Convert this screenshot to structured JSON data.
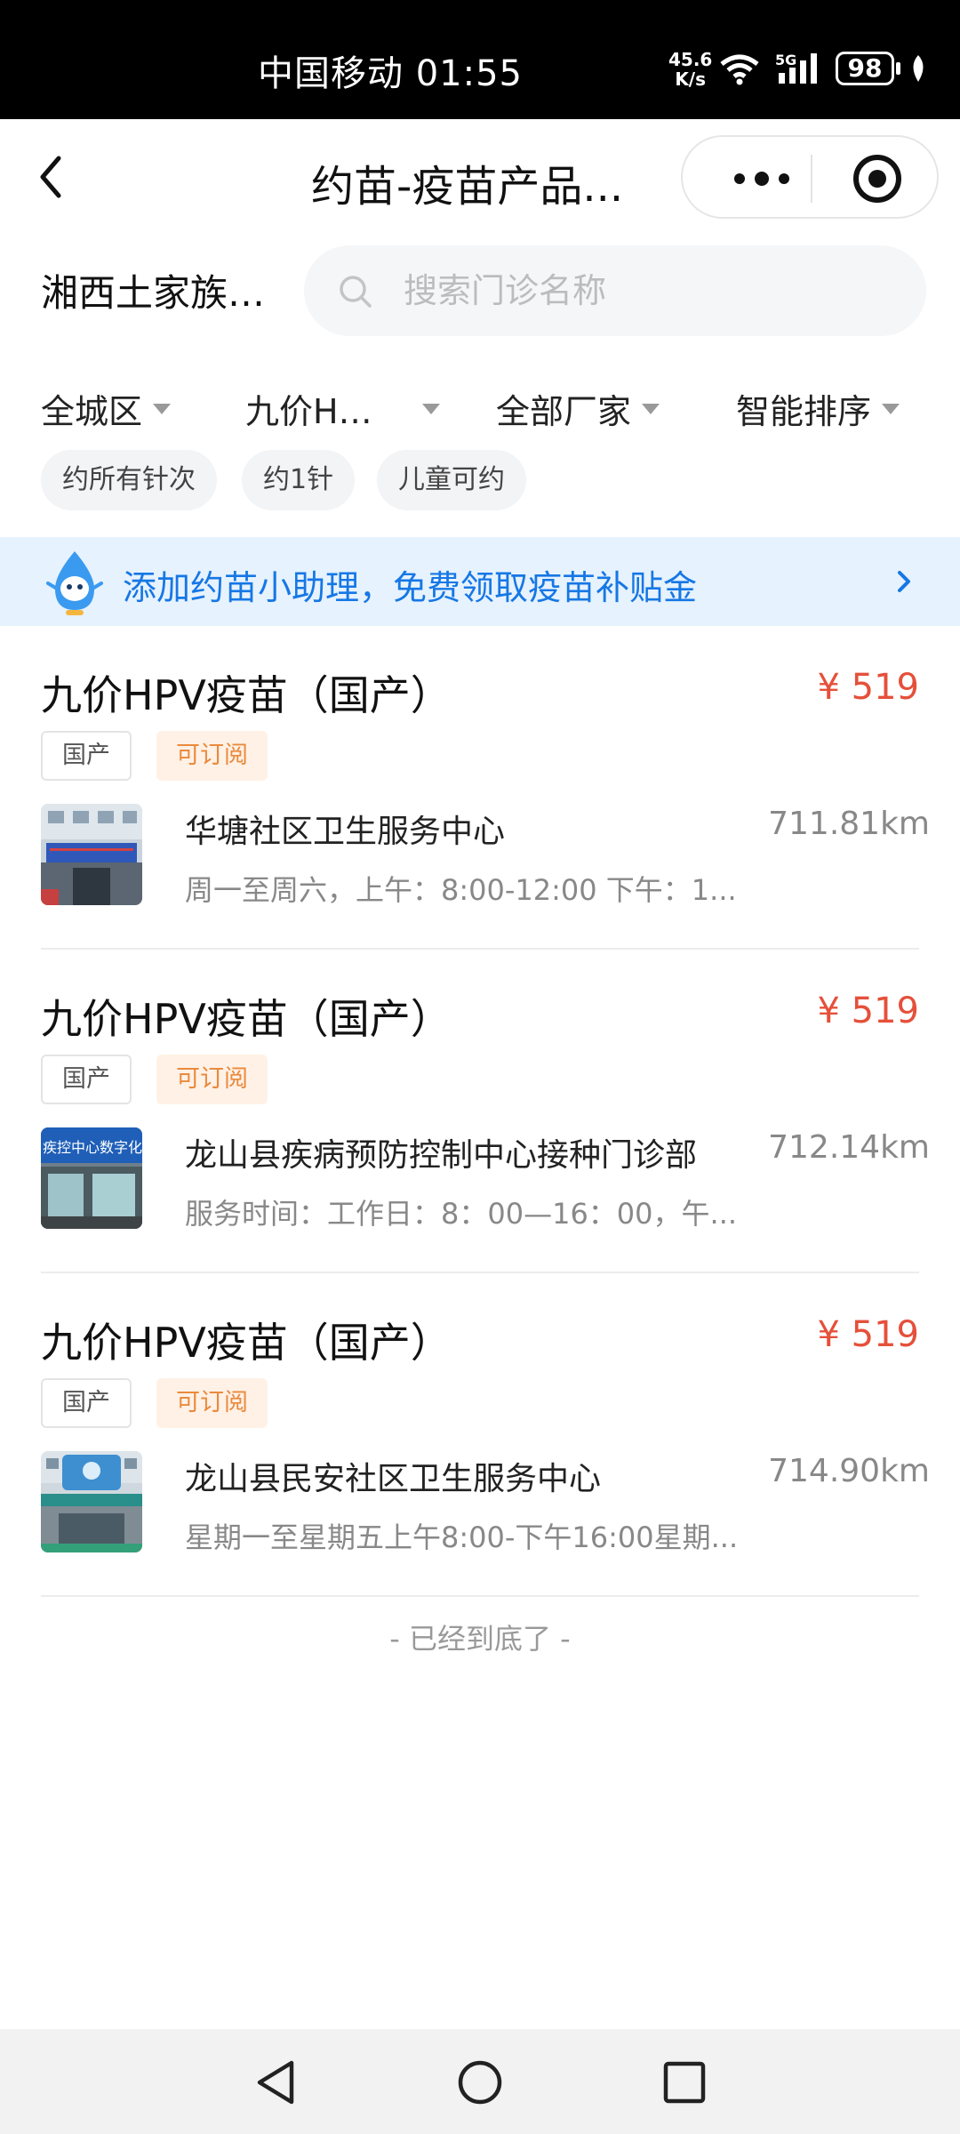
{
  "status_bar": {
    "carrier_time": "中国移动 01:55",
    "speed_value": "45.6",
    "speed_unit": "K/s",
    "network": "5G",
    "battery": "98"
  },
  "nav": {
    "title": "约苗-疫苗产品..."
  },
  "search": {
    "location": "湘西土家族…",
    "placeholder": "搜索门诊名称"
  },
  "filters": [
    {
      "label": "全城区"
    },
    {
      "label": "九价H…"
    },
    {
      "label": "全部厂家"
    },
    {
      "label": "智能排序"
    }
  ],
  "chips": [
    {
      "label": "约所有针次"
    },
    {
      "label": "约1针"
    },
    {
      "label": "儿童可约"
    }
  ],
  "banner": {
    "text": "添加约苗小助理，免费领取疫苗补贴金"
  },
  "items": [
    {
      "name": "九价HPV疫苗（国产）",
      "price": "¥ 519",
      "tag1": "国产",
      "tag2": "可订阅",
      "clinic": "华塘社区卫生服务中心",
      "distance": "711.81km",
      "hours": "周一至周六，上午：8:00-12:00 下午：1..."
    },
    {
      "name": "九价HPV疫苗（国产）",
      "price": "¥ 519",
      "tag1": "国产",
      "tag2": "可订阅",
      "clinic": "龙山县疾病预防控制中心接种门诊部",
      "distance": "712.14km",
      "hours": "服务时间：工作日：8：00—16：00，午..."
    },
    {
      "name": "九价HPV疫苗（国产）",
      "price": "¥ 519",
      "tag1": "国产",
      "tag2": "可订阅",
      "clinic": "龙山县民安社区卫生服务中心",
      "distance": "714.90km",
      "hours": "星期一至星期五上午8:00-下午16:00星期..."
    }
  ],
  "thumb_signs": [
    "疾控中心数字化"
  ],
  "end_text": "- 已经到底了 -",
  "colors": {
    "price": "#e5503a",
    "banner_text": "#1677e5",
    "subscribe_tag": "#ea8a3c"
  },
  "icons": [
    "back-icon",
    "more-icon",
    "target-icon",
    "search-icon",
    "mascot-icon",
    "chevron-right-icon",
    "nav-back-icon",
    "nav-home-icon",
    "nav-recents-icon"
  ]
}
